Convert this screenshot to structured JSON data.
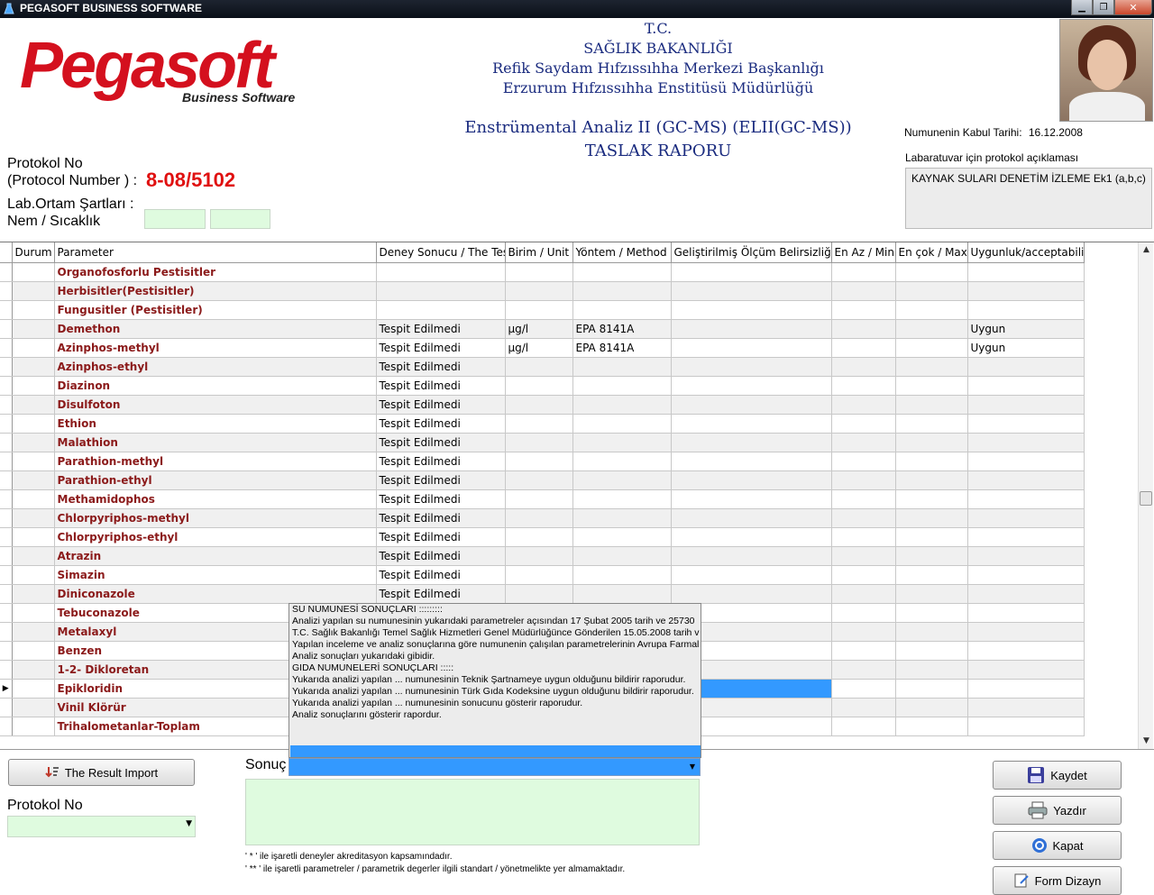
{
  "window": {
    "title": "PEGASOFT BUSINESS SOFTWARE"
  },
  "logo": {
    "main": "Pegasoft",
    "sub": "Business Software"
  },
  "header": {
    "line1": "T.C.",
    "line2": "SAĞLIK BAKANLIĞI",
    "line3": "Refik Saydam Hıfzıssıhha Merkezi Başkanlığı",
    "line4": "Erzurum Hıfzıssıhha Enstitüsü Müdürlüğü",
    "report_title": "Enstrümental Analiz II (GC-MS) (ELII(GC-MS))",
    "report_subtitle": "TASLAK RAPORU"
  },
  "acceptance": {
    "label": "Numunenin Kabul Tarihi:",
    "date": "16.12.2008"
  },
  "protocol_desc": {
    "label": "Labaratuvar için protokol açıklaması",
    "value": "KAYNAK SULARI DENETİM İZLEME Ek1 (a,b,c)"
  },
  "protocol": {
    "label1": "Protokol No",
    "label2": "(Protocol Number ) :",
    "number": "8-08/5102"
  },
  "lab": {
    "label1": "Lab.Ortam Şartları   :",
    "label2": "Nem / Sıcaklık"
  },
  "grid": {
    "columns": [
      "Durum",
      "Parameter",
      "Deney Sonucu / The Test",
      "Birim / Unit",
      "Yöntem / Method",
      "Geliştirilmiş Ölçüm Belirsizliği/",
      "En Az / Min",
      "En çok / Max",
      "Uygunluk/acceptability"
    ],
    "rows": [
      {
        "param": "Organofosforlu Pestisitler",
        "result": "",
        "unit": "",
        "method": "",
        "accept": ""
      },
      {
        "param": "Herbisitler(Pestisitler)",
        "result": "",
        "unit": "",
        "method": "",
        "accept": ""
      },
      {
        "param": "Fungusitler (Pestisitler)",
        "result": "",
        "unit": "",
        "method": "",
        "accept": ""
      },
      {
        "param": "Demethon",
        "result": "Tespit Edilmedi",
        "unit": "µg/l",
        "method": "EPA 8141A",
        "accept": "Uygun"
      },
      {
        "param": "Azinphos-methyl",
        "result": "Tespit Edilmedi",
        "unit": "µg/l",
        "method": "EPA 8141A",
        "accept": "Uygun"
      },
      {
        "param": "Azinphos-ethyl",
        "result": "Tespit Edilmedi",
        "unit": "",
        "method": "",
        "accept": ""
      },
      {
        "param": "Diazinon",
        "result": "Tespit Edilmedi",
        "unit": "",
        "method": "",
        "accept": ""
      },
      {
        "param": "Disulfoton",
        "result": "Tespit Edilmedi",
        "unit": "",
        "method": "",
        "accept": ""
      },
      {
        "param": "Ethion",
        "result": "Tespit Edilmedi",
        "unit": "",
        "method": "",
        "accept": ""
      },
      {
        "param": "Malathion",
        "result": "Tespit Edilmedi",
        "unit": "",
        "method": "",
        "accept": ""
      },
      {
        "param": "Parathion-methyl",
        "result": "Tespit Edilmedi",
        "unit": "",
        "method": "",
        "accept": ""
      },
      {
        "param": "Parathion-ethyl",
        "result": "Tespit Edilmedi",
        "unit": "",
        "method": "",
        "accept": ""
      },
      {
        "param": "Methamidophos",
        "result": "Tespit Edilmedi",
        "unit": "",
        "method": "",
        "accept": ""
      },
      {
        "param": "Chlorpyriphos-methyl",
        "result": "Tespit Edilmedi",
        "unit": "",
        "method": "",
        "accept": ""
      },
      {
        "param": "Chlorpyriphos-ethyl",
        "result": "Tespit Edilmedi",
        "unit": "",
        "method": "",
        "accept": ""
      },
      {
        "param": "Atrazin",
        "result": "Tespit Edilmedi",
        "unit": "",
        "method": "",
        "accept": ""
      },
      {
        "param": "Simazin",
        "result": "Tespit Edilmedi",
        "unit": "",
        "method": "",
        "accept": ""
      },
      {
        "param": "Diniconazole",
        "result": "Tespit Edilmedi",
        "unit": "",
        "method": "",
        "accept": ""
      },
      {
        "param": "Tebuconazole",
        "result": "",
        "unit": "",
        "method": "",
        "accept": ""
      },
      {
        "param": "Metalaxyl",
        "result": "",
        "unit": "",
        "method": "",
        "accept": ""
      },
      {
        "param": "Benzen",
        "result": "",
        "unit": "",
        "method": "",
        "accept": ""
      },
      {
        "param": "1-2- Dikloretan",
        "result": "",
        "unit": "",
        "method": "",
        "accept": ""
      },
      {
        "param": "Epikloridin",
        "result": "",
        "unit": "",
        "method": "",
        "accept": ""
      },
      {
        "param": "Vinil Klörür",
        "result": "",
        "unit": "",
        "method": "",
        "accept": ""
      },
      {
        "param": "Trihalometanlar-Toplam",
        "result": "",
        "unit": "",
        "method": "",
        "accept": ""
      }
    ]
  },
  "popup": {
    "lines": [
      "          SU NUMUNESİ SONUÇLARI :::::::::",
      "Analizi yapılan su numunesinin yukarıdaki parametreler açısından 17 Şubat 2005 tarih ve 25730",
      "T.C. Sağlık Bakanlığı Temel Sağlık Hizmetleri Genel Müdürlüğünce Gönderilen 15.05.2008 tarih v",
      "Yapılan inceleme ve analiz sonuçlarına göre numunenin çalışılan parametrelerinin Avrupa Farmal",
      "Analiz sonuçları yukarıdaki gibidir.",
      "          GIDA NUMUNELERİ SONUÇLARI :::::",
      "Yukarıda analizi yapılan ... numunesinin Teknik Şartnameye uygun olduğunu bildirir raporudur.",
      "Yukarıda analizi yapılan ... numunesinin Türk Gıda Kodeksine uygun olduğunu bildirir raporudur.",
      "Yukarıda analizi yapılan ... numunesinin sonucunu gösterir raporudur.",
      "Analiz sonuçlarını gösterir rapordur."
    ]
  },
  "sonuc": {
    "label": "Sonuç"
  },
  "buttons": {
    "result_import": "The Result Import",
    "save": "Kaydet",
    "print": "Yazdır",
    "close": "Kapat",
    "form_design": "Form Dizayn"
  },
  "protocol_select": {
    "label": "Protokol  No"
  },
  "notes": {
    "n1": "' * '  ile işaretli deneyler akreditasyon kapsamındadır.",
    "n2": "' ** ' ile işaretli parametreler / parametrik degerler ilgili standart / yönetmelikte yer almamaktadır."
  },
  "colors": {
    "brand_red": "#d4101e",
    "header_blue": "#1a2b7f",
    "param_red": "#8b1a1a",
    "selection": "#3399ff",
    "field_green": "#dffbdf"
  }
}
